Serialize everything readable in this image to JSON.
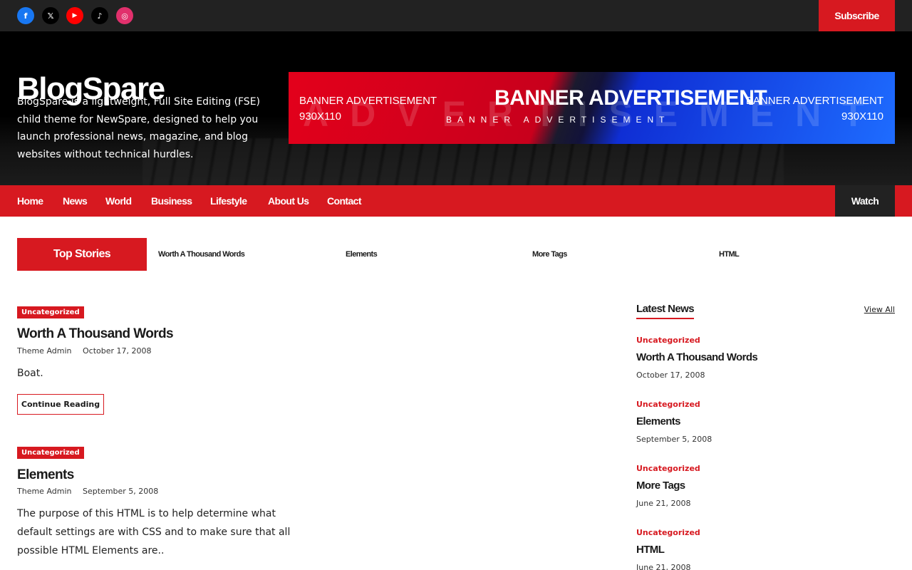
{
  "social": [
    {
      "icon": "facebook-icon",
      "glyph": "f",
      "color": "#1877f2"
    },
    {
      "icon": "x-icon",
      "glyph": "𝕏",
      "color": "#000000"
    },
    {
      "icon": "youtube-icon",
      "glyph": "▶",
      "color": "#ff0000"
    },
    {
      "icon": "tiktok-icon",
      "glyph": "♪",
      "color": "#000000"
    },
    {
      "icon": "instagram-icon",
      "glyph": "◎",
      "color": "#e1306c"
    }
  ],
  "topbar": {
    "subscribe_label": "Subscribe"
  },
  "site": {
    "title": "BlogSpare",
    "description": "BlogSpare is a lightweight, Full Site Editing (FSE) child theme for NewSpare, designed to help you launch professional news, magazine, and blog websites without technical hurdles."
  },
  "banner": {
    "left_text": "BANNER ADVERTISEMENT",
    "left_size": "930X110",
    "center_text": "BANNER ADVERTISEMENT",
    "center_sub": "BANNER ADVERTISEMENT",
    "right_text": "BANNER ADVERTISEMENT",
    "right_size": "930X110",
    "watermark": "ADVERTISEMENT"
  },
  "nav": {
    "items": [
      "Home",
      "News",
      "World",
      "Business",
      "Lifestyle",
      "About Us",
      "Contact"
    ],
    "watch_label": "Watch"
  },
  "ticker": {
    "label": "Top Stories",
    "links": [
      "Worth A Thousand Words",
      "Elements",
      "More Tags",
      "HTML"
    ]
  },
  "posts": [
    {
      "category": "Uncategorized",
      "title": "Worth A Thousand Words",
      "author": "Theme Admin",
      "date": "October 17, 2008",
      "excerpt": "Boat.",
      "button": "Continue Reading"
    },
    {
      "category": "Uncategorized",
      "title": "Elements",
      "author": "Theme Admin",
      "date": "September 5, 2008",
      "excerpt": "The purpose of this HTML is to help determine what default settings are with CSS and to make sure that all possible HTML Elements are.."
    }
  ],
  "sidebar": {
    "heading": "Latest News",
    "view_all": "View All",
    "items": [
      {
        "category": "Uncategorized",
        "title": "Worth A Thousand Words",
        "date": "October 17, 2008"
      },
      {
        "category": "Uncategorized",
        "title": "Elements",
        "date": "September 5, 2008"
      },
      {
        "category": "Uncategorized",
        "title": "More Tags",
        "date": "June 21, 2008"
      },
      {
        "category": "Uncategorized",
        "title": "HTML",
        "date": "June 21, 2008"
      }
    ]
  },
  "colors": {
    "accent": "#d71920",
    "dark": "#222222"
  }
}
